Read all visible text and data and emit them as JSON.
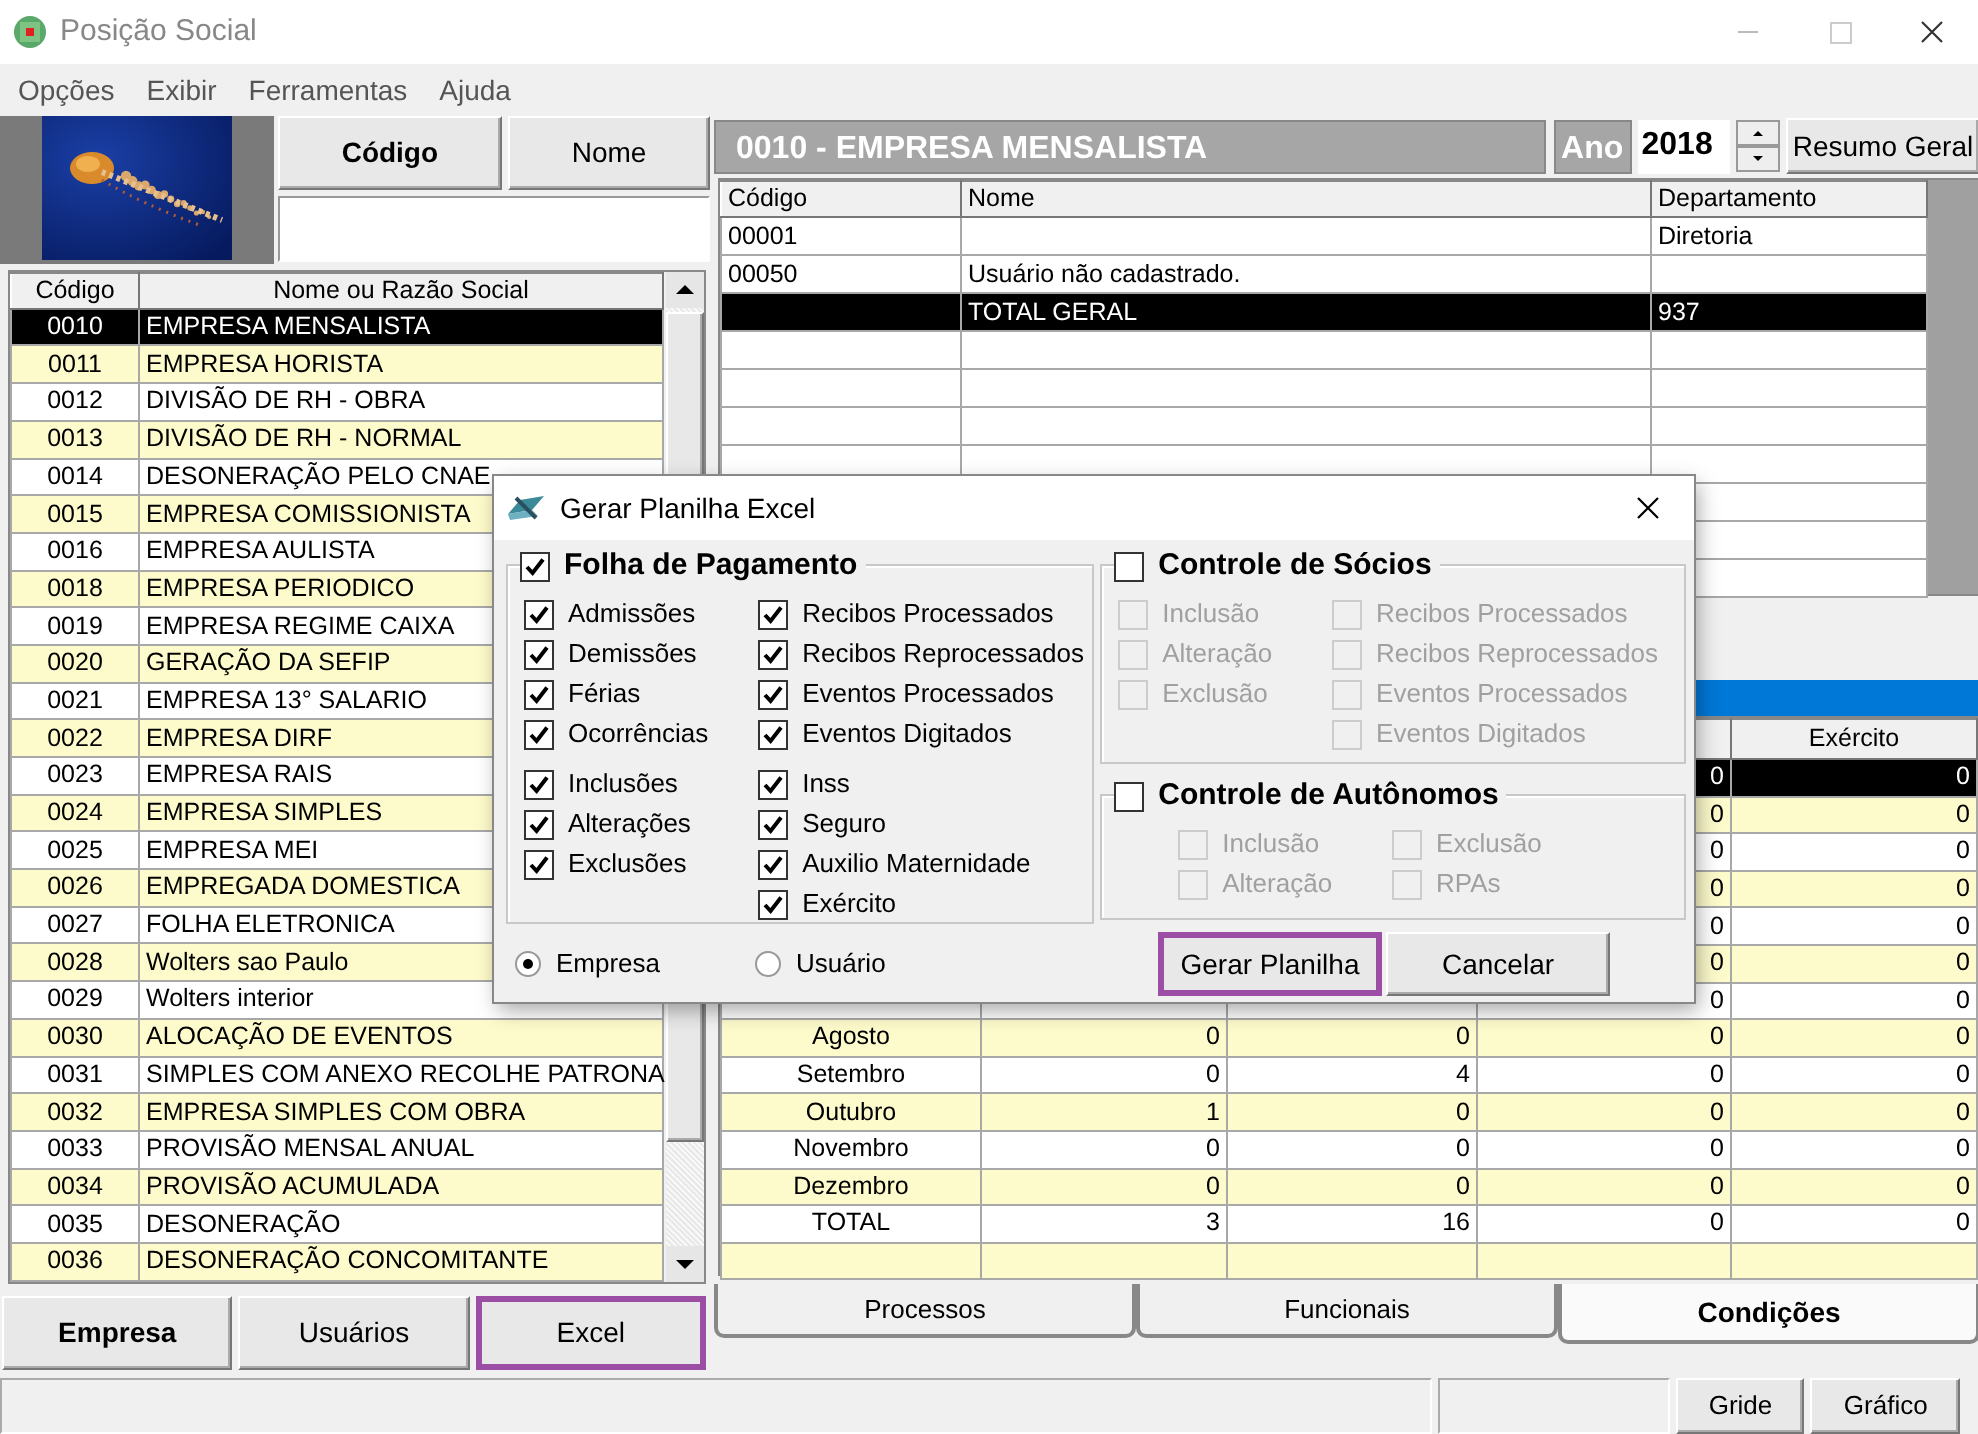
{
  "window": {
    "title": "Posição Social"
  },
  "menu": [
    "Opções",
    "Exibir",
    "Ferramentas",
    "Ajuda"
  ],
  "search": {
    "buttons": [
      {
        "label": "Código",
        "bold": true
      },
      {
        "label": "Nome",
        "bold": false
      }
    ]
  },
  "company_list": {
    "columns": [
      "Código",
      "Nome ou Razão Social"
    ],
    "rows": [
      {
        "code": "0010",
        "name": "EMPRESA MENSALISTA",
        "selected": true
      },
      {
        "code": "0011",
        "name": "EMPRESA HORISTA",
        "selected": false
      },
      {
        "code": "0012",
        "name": "DIVISÃO DE RH - OBRA",
        "selected": false
      },
      {
        "code": "0013",
        "name": "DIVISÃO DE RH - NORMAL",
        "selected": false
      },
      {
        "code": "0014",
        "name": "DESONERAÇÃO PELO CNAE",
        "selected": false
      },
      {
        "code": "0015",
        "name": "EMPRESA COMISSIONISTA",
        "selected": false
      },
      {
        "code": "0016",
        "name": "EMPRESA AULISTA",
        "selected": false
      },
      {
        "code": "0018",
        "name": "EMPRESA PERIODICO",
        "selected": false
      },
      {
        "code": "0019",
        "name": "EMPRESA REGIME CAIXA",
        "selected": false
      },
      {
        "code": "0020",
        "name": "GERAÇÃO DA SEFIP",
        "selected": false
      },
      {
        "code": "0021",
        "name": "EMPRESA 13° SALARIO",
        "selected": false
      },
      {
        "code": "0022",
        "name": "EMPRESA DIRF",
        "selected": false
      },
      {
        "code": "0023",
        "name": "EMPRESA RAIS",
        "selected": false
      },
      {
        "code": "0024",
        "name": "EMPRESA SIMPLES",
        "selected": false
      },
      {
        "code": "0025",
        "name": "EMPRESA MEI",
        "selected": false
      },
      {
        "code": "0026",
        "name": "EMPREGADA DOMESTICA",
        "selected": false
      },
      {
        "code": "0027",
        "name": "FOLHA ELETRONICA",
        "selected": false
      },
      {
        "code": "0028",
        "name": "Wolters sao Paulo",
        "selected": false
      },
      {
        "code": "0029",
        "name": "Wolters interior",
        "selected": false
      },
      {
        "code": "0030",
        "name": "ALOCAÇÃO DE EVENTOS",
        "selected": false
      },
      {
        "code": "0031",
        "name": "SIMPLES COM ANEXO RECOLHE PATRONA",
        "selected": false
      },
      {
        "code": "0032",
        "name": "EMPRESA SIMPLES COM OBRA",
        "selected": false
      },
      {
        "code": "0033",
        "name": "PROVISÃO MENSAL ANUAL",
        "selected": false
      },
      {
        "code": "0034",
        "name": "PROVISÃO ACUMULADA",
        "selected": false
      },
      {
        "code": "0035",
        "name": "DESONERAÇÃO",
        "selected": false
      },
      {
        "code": "0036",
        "name": "DESONERAÇÃO CONCOMITANTE",
        "selected": false
      }
    ]
  },
  "left_buttons": [
    {
      "label": "Empresa",
      "bold": true,
      "highlighted": false
    },
    {
      "label": "Usuários",
      "bold": false,
      "highlighted": false
    },
    {
      "label": "Excel",
      "bold": false,
      "highlighted": true
    }
  ],
  "header": {
    "title": "0010 - EMPRESA MENSALISTA",
    "year_label": "Ano",
    "year": "2018",
    "summary_button": "Resumo Geral"
  },
  "users_table": {
    "columns": [
      "Código",
      "Nome",
      "Departamento"
    ],
    "rows": [
      {
        "code": "00001",
        "department": "Diretoria",
        "selected": false
      },
      {
        "code": "00050",
        "name": "Usuário não cadastrado.",
        "selected": false
      },
      {
        "name": "TOTAL GERAL",
        "department": "937",
        "selected": true
      }
    ]
  },
  "month_table": {
    "column_5_header": "Exército",
    "rows": [
      {
        "column_4": "0",
        "column_5": "0",
        "selected": true
      },
      {
        "column_4": "0",
        "column_5": "0",
        "selected": false
      },
      {
        "column_4": "0",
        "column_5": "0",
        "selected": false
      },
      {
        "column_4": "0",
        "column_5": "0",
        "selected": false
      },
      {
        "column_4": "0",
        "column_5": "0",
        "selected": false
      },
      {
        "column_4": "0",
        "column_5": "0",
        "selected": false
      },
      {
        "column_4": "0",
        "column_5": "0",
        "selected": false
      },
      {
        "month": "Agosto",
        "column_2": "0",
        "column_3": "0",
        "column_4": "0",
        "column_5": "0",
        "selected": false
      },
      {
        "month": "Setembro",
        "column_2": "0",
        "column_3": "4",
        "column_4": "0",
        "column_5": "0",
        "selected": false
      },
      {
        "month": "Outubro",
        "column_2": "1",
        "column_3": "0",
        "column_4": "0",
        "column_5": "0",
        "selected": false
      },
      {
        "month": "Novembro",
        "column_2": "0",
        "column_3": "0",
        "column_4": "0",
        "column_5": "0",
        "selected": false
      },
      {
        "month": "Dezembro",
        "column_2": "0",
        "column_3": "0",
        "column_4": "0",
        "column_5": "0",
        "selected": false
      },
      {
        "month": "TOTAL",
        "column_2": "3",
        "column_3": "16",
        "column_4": "0",
        "column_5": "0",
        "selected": false
      }
    ]
  },
  "tabs": [
    {
      "label": "Processos",
      "selected": false
    },
    {
      "label": "Funcionais",
      "selected": false
    },
    {
      "label": "Condições",
      "selected": true
    }
  ],
  "status_bar": {
    "buttons": [
      "Gride",
      "Gráfico"
    ]
  },
  "dialog": {
    "title": "Gerar Planilha Excel",
    "groups": [
      {
        "label": "Folha de Pagamento",
        "checked": true,
        "columns": [
          [
            [
              {
                "label": "Admissões",
                "checked": true,
                "disabled": false
              },
              {
                "label": "Demissões",
                "checked": true,
                "disabled": false
              },
              {
                "label": "Férias",
                "checked": true,
                "disabled": false
              },
              {
                "label": "Ocorrências",
                "checked": true,
                "disabled": false
              }
            ],
            [
              {
                "label": "Inclusões",
                "checked": true,
                "disabled": false
              },
              {
                "label": "Alterações",
                "checked": true,
                "disabled": false
              },
              {
                "label": "Exclusões",
                "checked": true,
                "disabled": false
              }
            ]
          ],
          [
            [
              {
                "label": "Recibos Processados",
                "checked": true,
                "disabled": false
              },
              {
                "label": "Recibos Reprocessados",
                "checked": true,
                "disabled": false
              },
              {
                "label": "Eventos Processados",
                "checked": true,
                "disabled": false
              },
              {
                "label": "Eventos Digitados",
                "checked": true,
                "disabled": false
              }
            ],
            [
              {
                "label": "Inss",
                "checked": true,
                "disabled": false
              },
              {
                "label": "Seguro",
                "checked": true,
                "disabled": false
              },
              {
                "label": "Auxilio Maternidade",
                "checked": true,
                "disabled": false
              },
              {
                "label": "Exército",
                "checked": true,
                "disabled": false
              }
            ]
          ]
        ]
      },
      {
        "label": "Controle de Sócios",
        "checked": false,
        "columns": [
          [
            [
              {
                "label": "Inclusão",
                "checked": false,
                "disabled": true
              },
              {
                "label": "Alteração",
                "checked": false,
                "disabled": true
              },
              {
                "label": "Exclusão",
                "checked": false,
                "disabled": true
              }
            ]
          ],
          [
            [
              {
                "label": "Recibos Processados",
                "checked": false,
                "disabled": true
              },
              {
                "label": "Recibos Reprocessados",
                "checked": false,
                "disabled": true
              },
              {
                "label": "Eventos Processados",
                "checked": false,
                "disabled": true
              },
              {
                "label": "Eventos Digitados",
                "checked": false,
                "disabled": true
              }
            ]
          ]
        ]
      },
      {
        "label": "Controle de Autônomos",
        "checked": false,
        "columns": [
          [
            [
              {
                "label": "Inclusão",
                "checked": false,
                "disabled": true
              },
              {
                "label": "Alteração",
                "checked": false,
                "disabled": true
              }
            ]
          ],
          [
            [
              {
                "label": "Exclusão",
                "checked": false,
                "disabled": true
              },
              {
                "label": "RPAs",
                "checked": false,
                "disabled": true
              }
            ]
          ]
        ]
      }
    ],
    "options": [
      {
        "label": "Empresa",
        "selected": true
      },
      {
        "label": "Usuário",
        "selected": false
      }
    ],
    "buttons": [
      {
        "label": "Gerar Planilha",
        "highlighted": true
      },
      {
        "label": "Cancelar",
        "highlighted": false
      }
    ]
  }
}
